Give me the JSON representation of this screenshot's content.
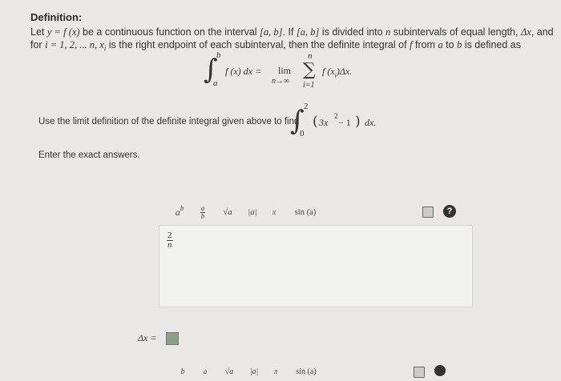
{
  "definition": {
    "heading": "Definition:",
    "line1": {
      "t1": "Let ",
      "eq": "y = f (x)",
      "t2": " be a continuous function on the interval ",
      "interval1": "[a, b]",
      "t3": ". If ",
      "interval2": "[a, b]",
      "t4": " is divided into ",
      "n": "n",
      "t5": " subintervals of equal length, ",
      "dx": "Δx",
      "t6": ", and"
    },
    "line2": {
      "t1": "for ",
      "ivals": "i = 1, 2, ... n, x",
      "sub_i": "i",
      "t2": " is the right endpoint of each subinterval, then the definite integral of ",
      "f": "f",
      "t3": " from ",
      "a": "a",
      "t4": " to ",
      "b": "b",
      "t5": " is defined as"
    },
    "formula": {
      "upper": "b",
      "lower": "a",
      "integrand": "f (x) dx =",
      "lim": "lim",
      "lim_sub": "n→∞",
      "sum_top": "n",
      "sum_bottom": "i=1",
      "summand": "f (x",
      "summand_sub": "i",
      "summand_end": ")Δx."
    }
  },
  "instruction": {
    "text": "Use the limit definition of the definite integral given above to find",
    "upper": "2",
    "lower": "0",
    "lparen": "(",
    "base": "3x",
    "exp": "2",
    "minus": " − 1",
    "rparen": ")",
    "dx": "dx."
  },
  "exact_label": "Enter the exact answers.",
  "toolbar": {
    "power": {
      "base": "a",
      "exp": "b"
    },
    "fraction": {
      "num": "a",
      "den": "b"
    },
    "sqrt": "√a",
    "abs": "|a|",
    "pi": "π",
    "sin": "sin (a)",
    "help": "?"
  },
  "editor1": {
    "frac_num": "2",
    "frac_den": "n"
  },
  "answer_label": "Δx =",
  "toolbar2": {
    "power_base": "b",
    "fraction_num": "a",
    "sqrt": "√a",
    "abs": "|a|",
    "pi": "π",
    "sin": "sin (a)"
  }
}
